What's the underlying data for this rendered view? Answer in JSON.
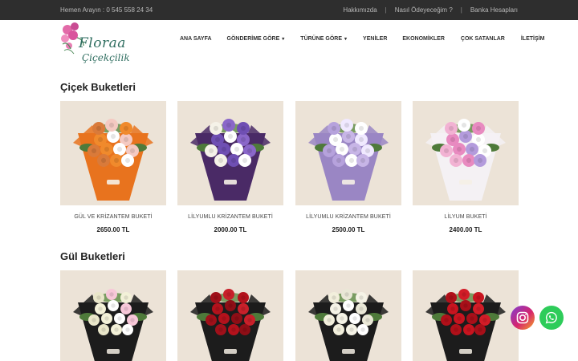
{
  "topbar": {
    "phone": "Hemen Arayın : 0 545 558 24 34",
    "links": [
      "Hakkımızda",
      "Nasıl Ödeyeceğim ?",
      "Banka Hesapları"
    ],
    "separator": "|"
  },
  "logo": {
    "line1": "Floraa",
    "line2": "Çiçekçilik"
  },
  "nav": {
    "items": [
      {
        "label": "ANA SAYFA",
        "dropdown": false
      },
      {
        "label": "GÖNDERİME GÖRE",
        "dropdown": true
      },
      {
        "label": "TÜRÜNE GÖRE",
        "dropdown": true
      },
      {
        "label": "YENİLER",
        "dropdown": false
      },
      {
        "label": "EKONOMİKLER",
        "dropdown": false
      },
      {
        "label": "ÇOK SATANLAR",
        "dropdown": false
      },
      {
        "label": "İLETİŞİM",
        "dropdown": false
      }
    ],
    "caret": "▾"
  },
  "sections": [
    {
      "title": "Çiçek Buketleri",
      "products": [
        {
          "name": "GÜL VE KRİZANTEM BUKETİ",
          "price": "2650.00 TL",
          "wrap": "#e8731e",
          "flowers": [
            "#f08a2c",
            "#ffffff",
            "#f4c9c1",
            "#d97a3a"
          ]
        },
        {
          "name": "LİLYUMLU KRİZANTEM BUKETİ",
          "price": "2000.00 TL",
          "wrap": "#4a2a66",
          "flowers": [
            "#6f4fb3",
            "#ffffff",
            "#8a67c9",
            "#f5f2e8"
          ]
        },
        {
          "name": "LİLYUMLU KRİZANTEM BUKETİ",
          "price": "2500.00 TL",
          "wrap": "#9a86c4",
          "flowers": [
            "#ffffff",
            "#c7b5e6",
            "#f0e9ff",
            "#b6a2dc"
          ]
        },
        {
          "name": "LİLYUM BUKETİ",
          "price": "2400.00 TL",
          "wrap": "#f4f1f4",
          "flowers": [
            "#e88ac0",
            "#b39bdc",
            "#ffffff",
            "#f2b2d3"
          ]
        }
      ]
    },
    {
      "title": "Gül Buketleri",
      "products": [
        {
          "name": "",
          "price": "",
          "wrap": "#1c1c1c",
          "flowers": [
            "#f3f1d8",
            "#ffffff",
            "#f7c7d8",
            "#e9e6c9"
          ]
        },
        {
          "name": "",
          "price": "",
          "wrap": "#1c1c1c",
          "flowers": [
            "#b3121c",
            "#8e0e16",
            "#c8202a",
            "#a0101a"
          ]
        },
        {
          "name": "",
          "price": "",
          "wrap": "#1c1c1c",
          "flowers": [
            "#f5f3e6",
            "#ffffff",
            "#e9e7d6",
            "#f2efdc"
          ]
        },
        {
          "name": "",
          "price": "",
          "wrap": "#1c1c1c",
          "flowers": [
            "#c8141f",
            "#a80f19",
            "#d21c27",
            "#b01019"
          ]
        }
      ]
    }
  ],
  "floating": [
    {
      "icon": "instagram-icon"
    },
    {
      "icon": "whatsapp-icon"
    }
  ]
}
